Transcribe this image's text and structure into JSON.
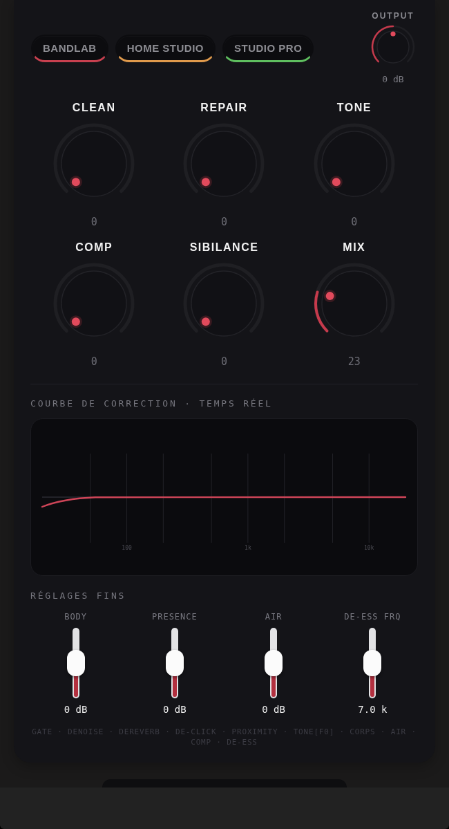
{
  "presets": [
    {
      "label": "BANDLAB",
      "color": "#c8404f",
      "selected": false
    },
    {
      "label": "HOME STUDIO",
      "color": "#e09a4c",
      "selected": false
    },
    {
      "label": "STUDIO PRO",
      "color": "#5fbf5f",
      "selected": false
    }
  ],
  "output": {
    "label": "OUTPUT",
    "level": 0.5,
    "reading": "0 dB"
  },
  "knobs": [
    {
      "label": "CLEAN",
      "reading": "0"
    },
    {
      "label": "REPAIR",
      "reading": "0"
    },
    {
      "label": "TONE",
      "reading": "0"
    },
    {
      "label": "COMP",
      "reading": "0"
    },
    {
      "label": "SIBILANCE",
      "reading": "0"
    },
    {
      "label": "MIX",
      "level": 0.23,
      "reading": "23"
    }
  ],
  "curve": {
    "title": "COURBE DE CORRECTION · TEMPS RÉEL",
    "tick_labels": [
      "100",
      "1k",
      "10k"
    ]
  },
  "fine": {
    "title": "RÉGLAGES FINS",
    "sliders": [
      {
        "label": "BODY",
        "level": 0.5,
        "reading": "0 dB"
      },
      {
        "label": "PRESENCE",
        "level": 0.5,
        "reading": "0 dB"
      },
      {
        "label": "AIR",
        "level": 0.5,
        "reading": "0 dB"
      },
      {
        "label": "DE-ESS FRQ",
        "level": 0.5,
        "reading": "7.0 k"
      }
    ]
  },
  "modules": "GATE · DENOISE · DEREVERB · DE-CLICK · PROXIMITY · TONE[F0] · CORPS · AIR · COMP · DE-ESS"
}
